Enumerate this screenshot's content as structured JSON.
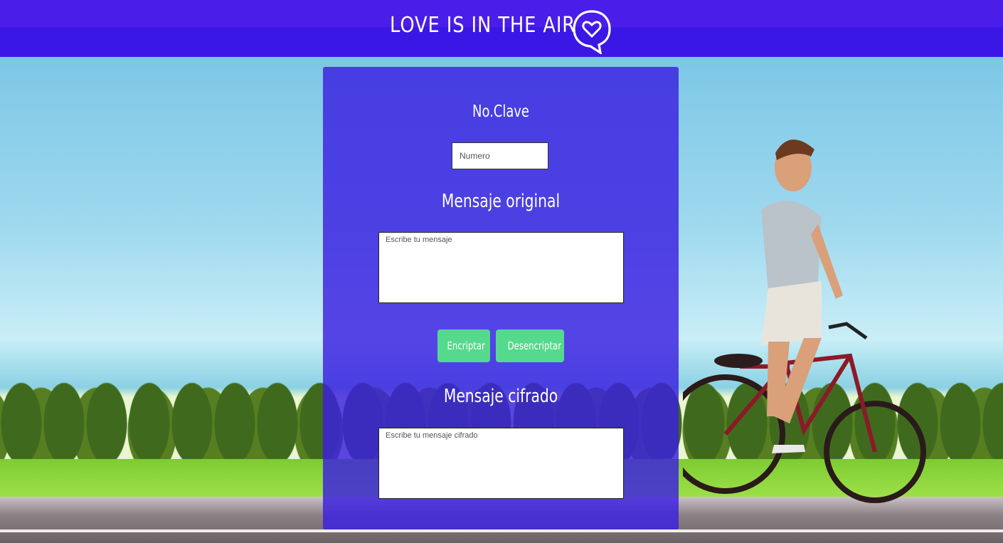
{
  "header": {
    "title": "LOVE IS IN THE AIR",
    "icon": "heart-speech-bubble-icon",
    "background": "#4a1de8"
  },
  "form": {
    "key_label": "No.Clave",
    "key_placeholder": "Numero",
    "original_label": "Mensaje original",
    "original_placeholder": "Escribe tu mensaje",
    "encrypt_label": "Encriptar",
    "decrypt_label": "Desencriptar",
    "cipher_label": "Mensaje cifrado",
    "cipher_placeholder": "Escribe tu mensaje cifrado",
    "panel_color": "#3a1fe1",
    "button_color": "#55d98c"
  }
}
